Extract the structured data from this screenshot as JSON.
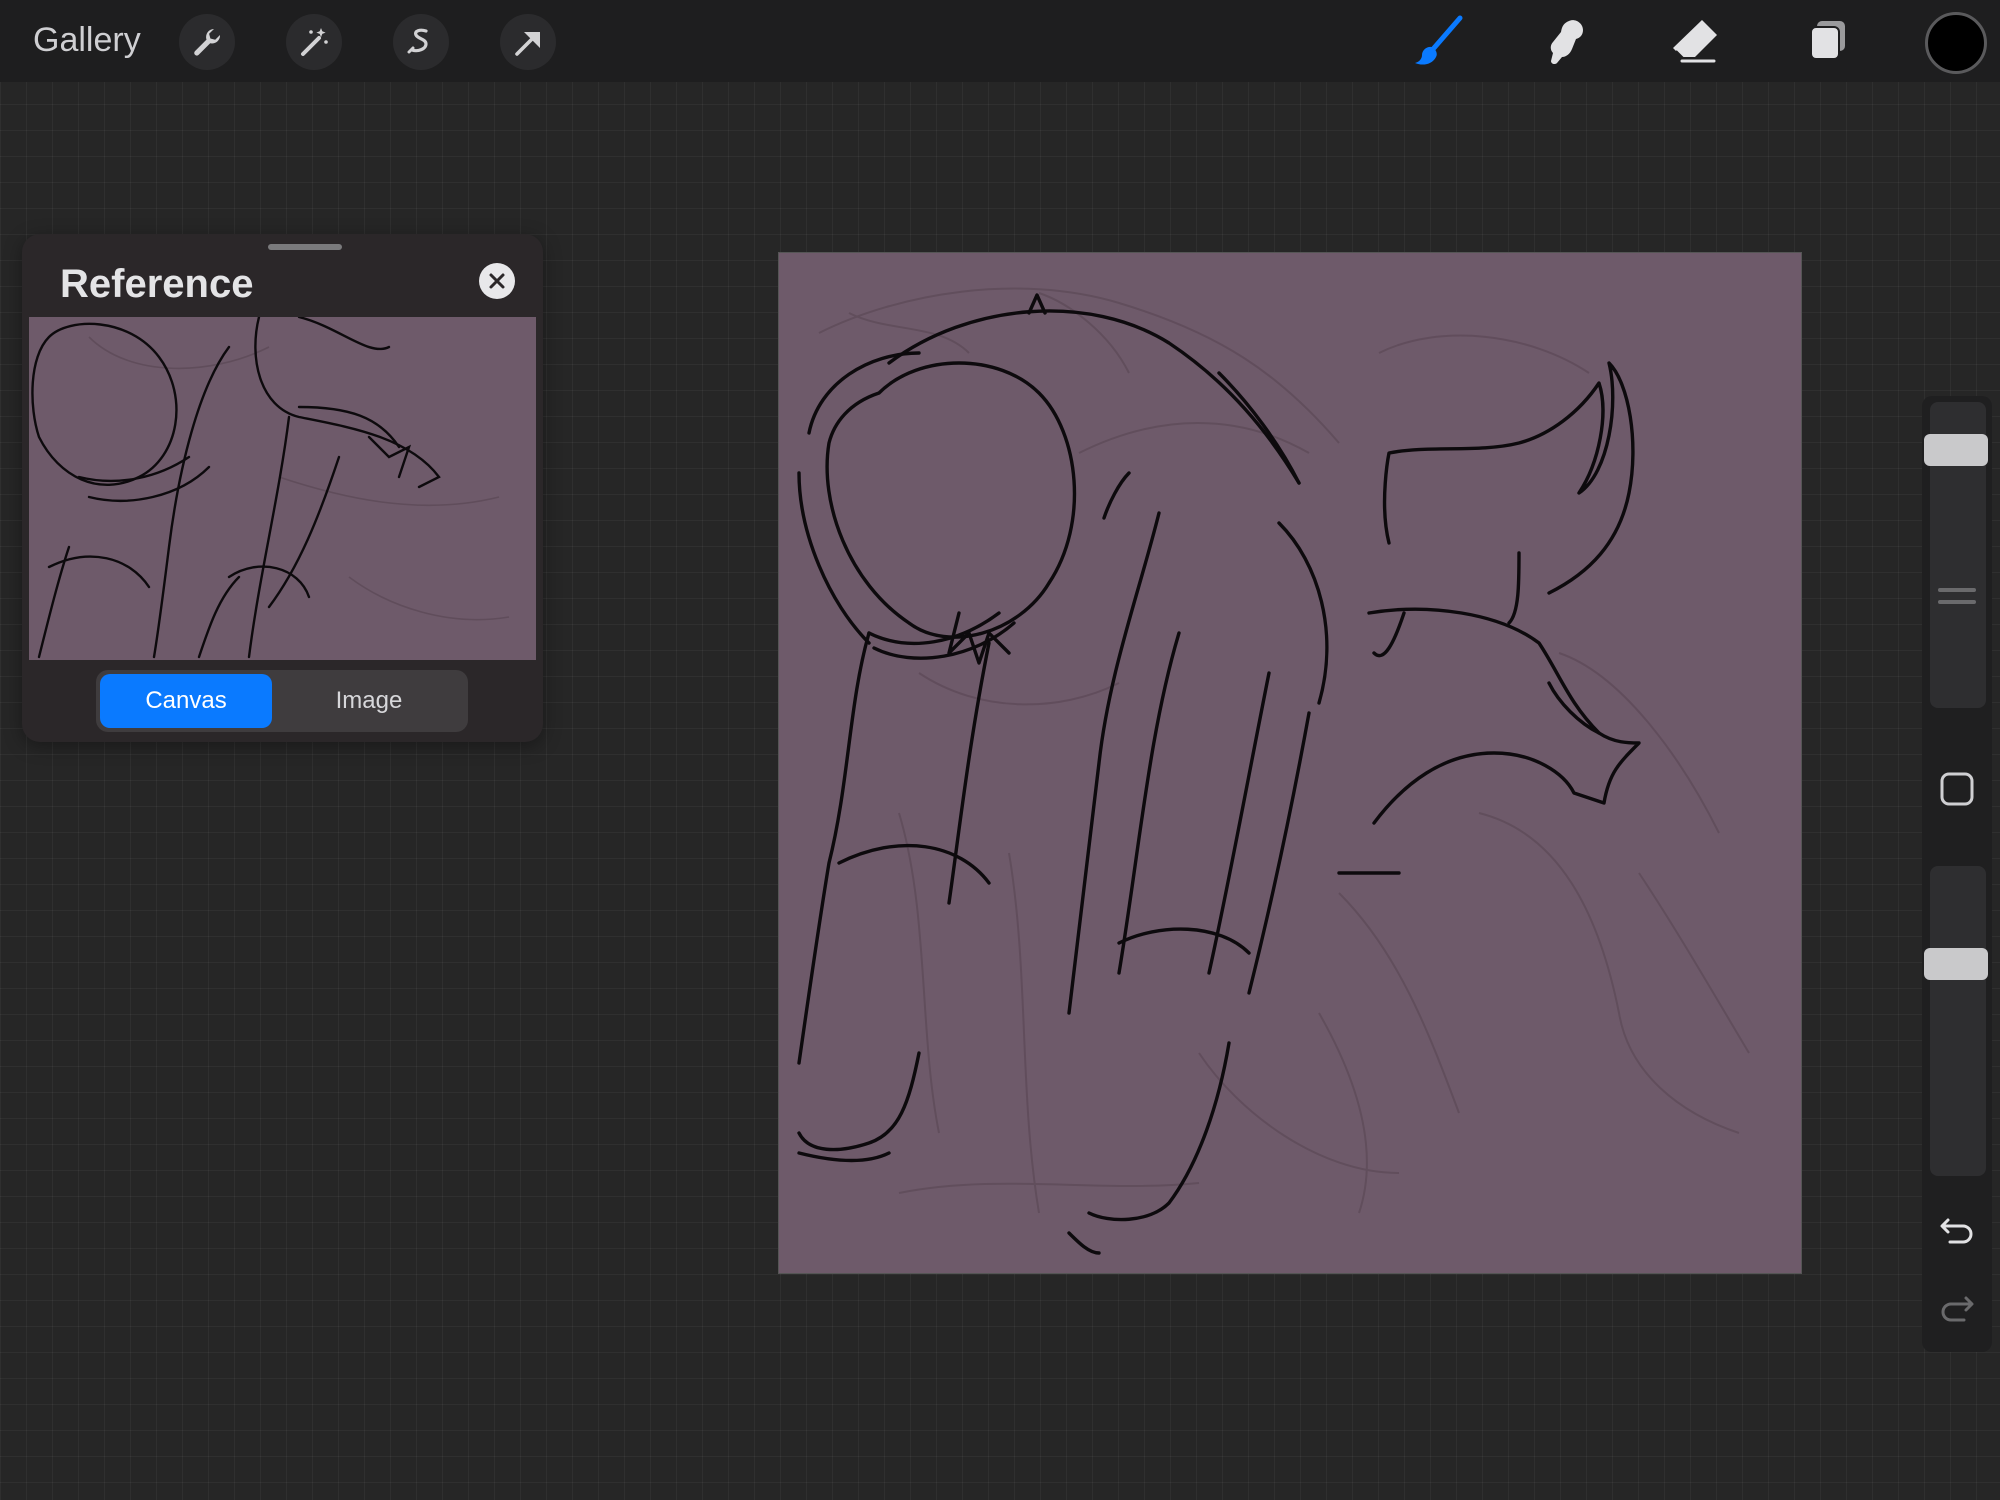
{
  "topbar": {
    "gallery_label": "Gallery",
    "left_tools": [
      "wrench-icon",
      "magic-wand-icon",
      "selection-icon",
      "transform-arrow-icon"
    ],
    "right_tools": [
      "brush-icon",
      "smudge-icon",
      "eraser-icon",
      "layers-icon"
    ],
    "active_tool": "brush",
    "current_color": "#000000",
    "accent_color": "#0a7aff"
  },
  "reference_panel": {
    "title": "Reference",
    "tabs": [
      {
        "label": "Canvas",
        "active": true
      },
      {
        "label": "Image",
        "active": false
      }
    ]
  },
  "canvas": {
    "background_color": "#6e5a6a"
  },
  "sidebar": {
    "brush_size_level": 0.05,
    "opacity_level": 0.3,
    "controls": [
      "brush-size-slider",
      "modify-button",
      "opacity-slider",
      "undo-icon",
      "redo-icon"
    ]
  }
}
